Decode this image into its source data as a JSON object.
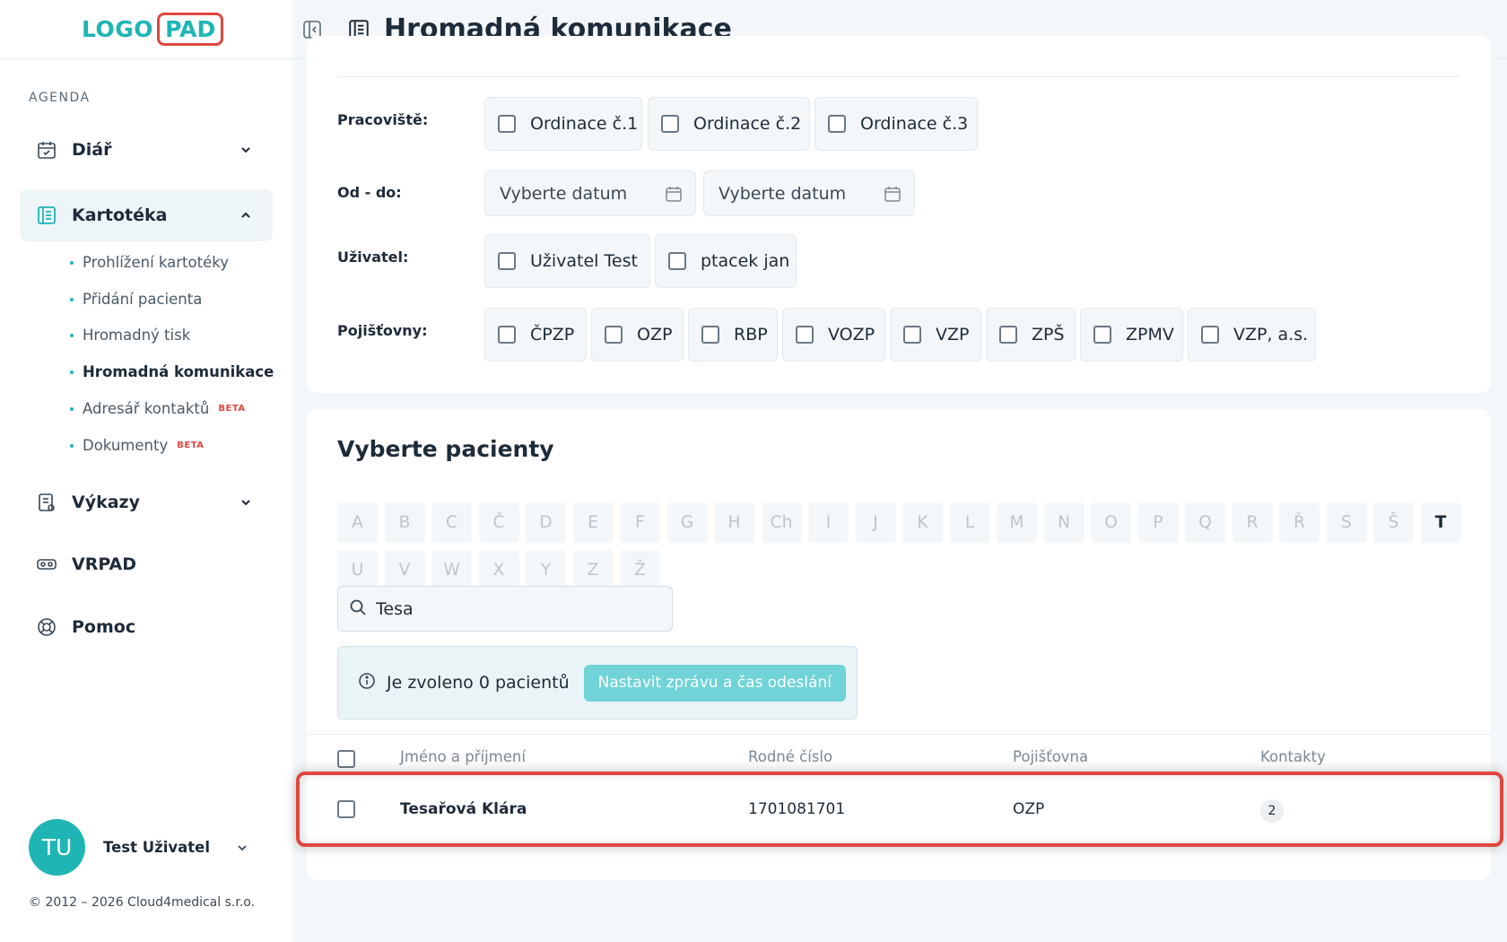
{
  "logo": {
    "text": "LOGO",
    "pad": "PAD"
  },
  "sidebar": {
    "section": "AGENDA",
    "items": [
      {
        "label": "Diář"
      },
      {
        "label": "Kartotéka"
      },
      {
        "label": "Výkazy"
      },
      {
        "label": "VRPAD"
      },
      {
        "label": "Pomoc"
      }
    ],
    "subitems": [
      {
        "label": "Prohlížení kartotéky"
      },
      {
        "label": "Přidání pacienta"
      },
      {
        "label": "Hromadný tisk"
      },
      {
        "label": "Hromadná komunikace"
      },
      {
        "label": "Adresář kontaktů",
        "badge": "BETA"
      },
      {
        "label": "Dokumenty",
        "badge": "BETA"
      }
    ],
    "user": {
      "initials": "TU",
      "name": "Test Uživatel"
    },
    "copyright": "© 2012 – 2026 Cloud4medical s.r.o."
  },
  "header": {
    "title": "Hromadná komunikace"
  },
  "filters": {
    "workplace_label": "Pracoviště:",
    "workplaces": [
      "Ordinace č.1",
      "Ordinace č.2",
      "Ordinace č.3"
    ],
    "date_label": "Od - do:",
    "date_from_placeholder": "Vyberte datum",
    "date_to_placeholder": "Vyberte datum",
    "user_label": "Uživatel:",
    "users": [
      "Uživatel Test",
      "ptacek jan"
    ],
    "insurance_label": "Pojišťovny:",
    "insurances": [
      "ČPZP",
      "OZP",
      "RBP",
      "VOZP",
      "VZP",
      "ZPŠ",
      "ZPMV",
      "VZP, a.s."
    ]
  },
  "patients": {
    "title": "Vyberte pacienty",
    "letters_row1": [
      "A",
      "B",
      "C",
      "Č",
      "D",
      "E",
      "F",
      "G",
      "H",
      "Ch",
      "I",
      "J",
      "K",
      "L",
      "M",
      "N",
      "O",
      "P",
      "Q",
      "R",
      "Ř",
      "S",
      "Š",
      "T"
    ],
    "letters_row2": [
      "U",
      "V",
      "W",
      "X",
      "Y",
      "Z",
      "Ž"
    ],
    "active_letter": "T",
    "search_value": "Tesa",
    "info_text": "Je zvoleno 0 pacientů",
    "info_button": "Nastavit zprávu a čas odeslání",
    "columns": {
      "name": "Jméno a příjmení",
      "birth": "Rodné číslo",
      "insurance": "Pojišťovna",
      "contacts": "Kontakty"
    },
    "rows": [
      {
        "name": "Tesařová Klára",
        "birth": "1701081701",
        "insurance": "OZP",
        "contacts": "2"
      }
    ]
  }
}
